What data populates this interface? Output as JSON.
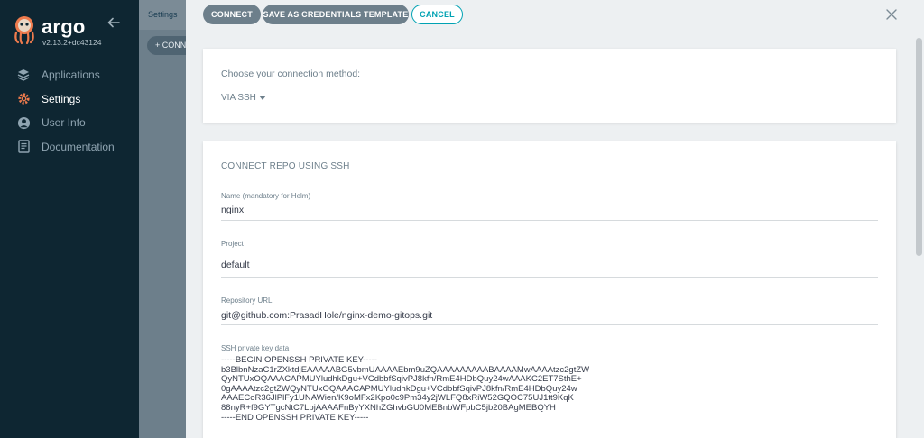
{
  "sidebar": {
    "app_name": "argo",
    "version": "v2.13.2+dc43124",
    "items": [
      {
        "label": "Applications",
        "icon": "layers-icon",
        "active": false
      },
      {
        "label": "Settings",
        "icon": "gear-icon",
        "active": true
      },
      {
        "label": "User Info",
        "icon": "user-icon",
        "active": false
      },
      {
        "label": "Documentation",
        "icon": "book-icon",
        "active": false
      }
    ]
  },
  "background": {
    "breadcrumb": "Settings",
    "connect_button": "+ CONN"
  },
  "panel": {
    "buttons": {
      "connect": "CONNECT",
      "save_template": "SAVE AS CREDENTIALS TEMPLATE",
      "cancel": "CANCEL"
    },
    "method": {
      "label": "Choose your connection method:",
      "selected": "VIA SSH"
    },
    "form": {
      "title": "CONNECT REPO USING SSH",
      "name_label": "Name (mandatory for Helm)",
      "name_value": "nginx",
      "project_label": "Project",
      "project_value": "default",
      "repo_url_label": "Repository URL",
      "repo_url_value": "git@github.com:PrasadHole/nginx-demo-gitops.git",
      "ssh_key_label": "SSH private key data",
      "ssh_key_value": "-----BEGIN OPENSSH PRIVATE KEY-----\nb3BlbnNzaC1rZXktdjEAAAAABG5vbmUAAAAEbm9uZQAAAAAAAAABAAAAMwAAAAtzc2gtZW\nQyNTUxOQAAACAPMUYludhkDgu+VCdbbfSqivPJ8kfn/RmE4HDbQuy24wAAAKC2ET7SthE+\n0gAAAAtzc2gtZWQyNTUxOQAAACAPMUYludhkDgu+VCdbbfSqivPJ8kfn/RmE4HDbQuy24w\nAAAECoR36JlPlFy1UNAWien/K9oMFx2Kpo0c9Pm34y2jWLFQ8xRiW52GQOC75UJ1tt9KqK\n88nyR+f9GYTgcNtC7LbjAAAAFnByYXNhZGhvbGU0MEBnbWFpbC5jb20BAgMEBQYH\n-----END OPENSSH PRIVATE KEY-----"
    }
  },
  "colors": {
    "sidebar_bg": "#0e2632",
    "accent": "#00a2b3",
    "logo_orange": "#ef7b4d",
    "button_gray": "#6d7f8b"
  }
}
